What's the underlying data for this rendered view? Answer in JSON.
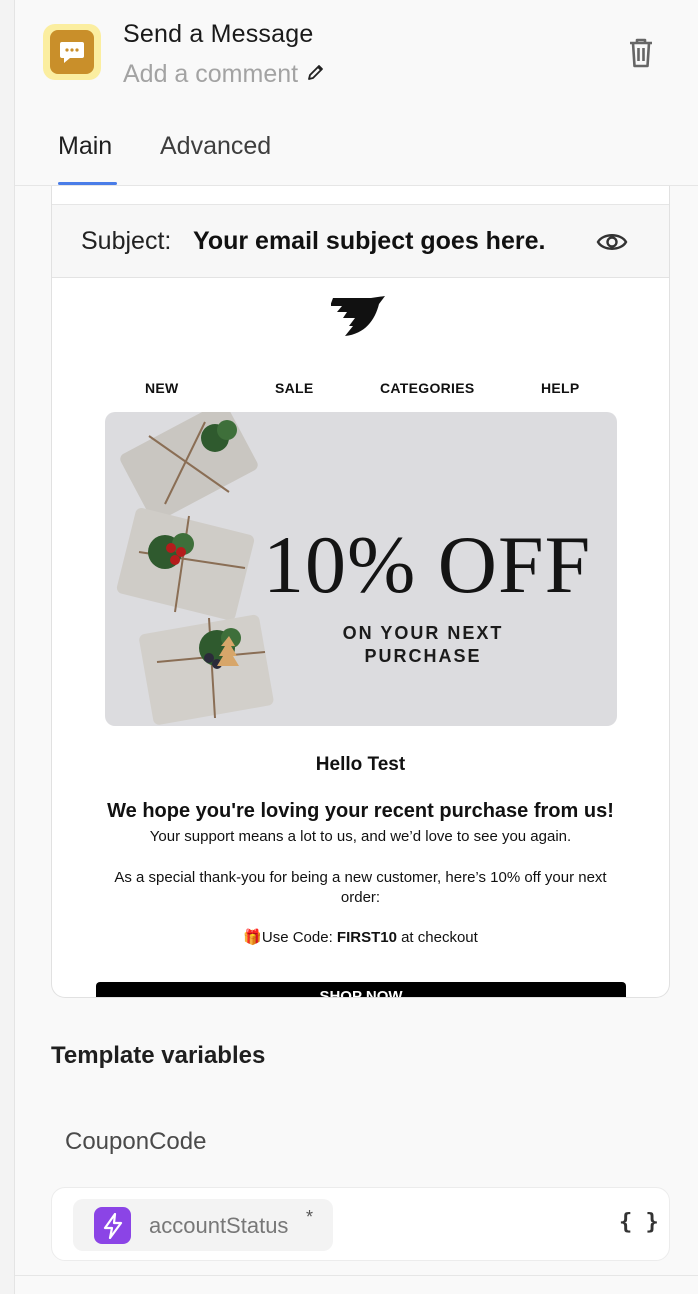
{
  "header": {
    "title": "Send a Message",
    "comment_placeholder": "Add a comment",
    "action_icon": "message-bubble-icon",
    "accent_color": "#c98f2a"
  },
  "tabs": [
    {
      "label": "Main",
      "active": true
    },
    {
      "label": "Advanced",
      "active": false
    }
  ],
  "preview": {
    "subject_label": "Subject:",
    "subject_value": "Your email subject goes here.",
    "nav": [
      "NEW",
      "SALE",
      "CATEGORIES",
      "HELP"
    ],
    "hero": {
      "headline": "10% OFF",
      "subline": "ON YOUR NEXT PURCHASE"
    },
    "greeting": "Hello Test",
    "headline": "We hope you're loving your recent purchase from us!",
    "support_text": "Your support means a lot to us, and we’d love to see you again.",
    "special_text": "As a special thank-you for being a new customer, here’s 10% off your next order:",
    "code_prefix": "🎁Use Code: ",
    "code": "FIRST10",
    "code_suffix": " at checkout",
    "button_label": "SHOP NOW"
  },
  "template_variables": {
    "title": "Template variables",
    "items": [
      {
        "name": "CouponCode",
        "value": "accountStatus",
        "required_marker": "*",
        "value_icon": "lightning-bolt-icon",
        "value_icon_color": "#8b44e6",
        "insert_label": "{ }"
      }
    ]
  }
}
